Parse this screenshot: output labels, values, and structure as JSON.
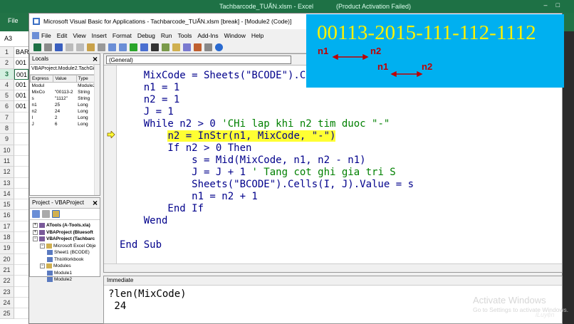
{
  "excel": {
    "title_left": "Tachbarcode_TUẤN.xlsm - Excel",
    "title_right": "(Product Activation Failed)",
    "file_tab": "File",
    "name_box": "A3",
    "rows": [
      {
        "n": "1",
        "c": "BAR"
      },
      {
        "n": "2",
        "c": "001"
      },
      {
        "n": "3",
        "c": "001",
        "sel": true
      },
      {
        "n": "4",
        "c": "001"
      },
      {
        "n": "5",
        "c": "001"
      },
      {
        "n": "6",
        "c": "001"
      },
      {
        "n": "7",
        "c": ""
      },
      {
        "n": "8",
        "c": ""
      },
      {
        "n": "9",
        "c": ""
      },
      {
        "n": "10",
        "c": ""
      },
      {
        "n": "11",
        "c": ""
      },
      {
        "n": "12",
        "c": ""
      },
      {
        "n": "13",
        "c": ""
      },
      {
        "n": "14",
        "c": ""
      },
      {
        "n": "15",
        "c": ""
      },
      {
        "n": "16",
        "c": ""
      },
      {
        "n": "17",
        "c": ""
      },
      {
        "n": "18",
        "c": ""
      },
      {
        "n": "19",
        "c": ""
      },
      {
        "n": "20",
        "c": ""
      },
      {
        "n": "21",
        "c": ""
      },
      {
        "n": "22",
        "c": ""
      },
      {
        "n": "23",
        "c": ""
      },
      {
        "n": "24",
        "c": ""
      },
      {
        "n": "25",
        "c": ""
      }
    ]
  },
  "vba": {
    "title": "Microsoft Visual Basic for Applications - Tachbarcode_TUẤN.xlsm [break] - [Module2 (Code)]",
    "menu": [
      "File",
      "Edit",
      "View",
      "Insert",
      "Format",
      "Debug",
      "Run",
      "Tools",
      "Add-Ins",
      "Window",
      "Help"
    ],
    "locals": {
      "title": "Locals",
      "project_path": "VBAProject.Module2.TachGi",
      "headers": [
        "Express",
        "Value",
        "Type"
      ],
      "rows": [
        {
          "e": "Modul",
          "v": "",
          "t": "Module2/M"
        },
        {
          "e": "MixCo",
          "v": "\"00113-2",
          "t": "String"
        },
        {
          "e": "s",
          "v": "\"1112\"",
          "t": "String"
        },
        {
          "e": "n1",
          "v": "25",
          "t": "Long"
        },
        {
          "e": "n2",
          "v": "24",
          "t": "Long"
        },
        {
          "e": "I",
          "v": "2",
          "t": "Long"
        },
        {
          "e": "J",
          "v": "6",
          "t": "Long"
        }
      ]
    },
    "project": {
      "title": "Project - VBAProject",
      "items": [
        {
          "label": "ATools (A-Tools.xla)",
          "bold": true,
          "indent": 0
        },
        {
          "label": "VBAProject (Bluesoft",
          "bold": true,
          "indent": 0
        },
        {
          "label": "VBAProject (Tachbarc",
          "bold": true,
          "indent": 0
        },
        {
          "label": "Microsoft Excel Obje",
          "bold": false,
          "indent": 1
        },
        {
          "label": "Sheet1 (BCODE)",
          "bold": false,
          "indent": 2
        },
        {
          "label": "ThisWorkbook",
          "bold": false,
          "indent": 2
        },
        {
          "label": "Modules",
          "bold": false,
          "indent": 1
        },
        {
          "label": "Module1",
          "bold": false,
          "indent": 2
        },
        {
          "label": "Module2",
          "bold": false,
          "indent": 2
        }
      ]
    },
    "code": {
      "combo": "(General)",
      "lines": [
        {
          "text": "    MixCode = Sheets(\"BCODE\").C",
          "comment": "",
          "hl": false
        },
        {
          "text": "    n1 = 1",
          "comment": "",
          "hl": false
        },
        {
          "text": "    n2 = 1",
          "comment": "",
          "hl": false
        },
        {
          "text": "    J = 1",
          "comment": "",
          "hl": false
        },
        {
          "text": "    While n2 > 0 ",
          "comment": "'CHi lap khi n2 tim duoc \"-\"",
          "hl": false
        },
        {
          "text": "        ",
          "hltext": "n2 = InStr(n1, MixCode, \"-\")",
          "comment": "",
          "hl": true
        },
        {
          "text": "        If n2 > 0 Then",
          "comment": "",
          "hl": false
        },
        {
          "text": "            s = Mid(MixCode, n1, n2 - n1)",
          "comment": "",
          "hl": false
        },
        {
          "text": "            J = J + 1 ",
          "comment": "' Tang cot ghi gia tri S",
          "hl": false
        },
        {
          "text": "            Sheets(\"BCODE\").Cells(I, J).Value = s",
          "comment": "",
          "hl": false
        },
        {
          "text": "            n1 = n2 + 1",
          "comment": "",
          "hl": false
        },
        {
          "text": "        End If",
          "comment": "",
          "hl": false
        },
        {
          "text": "    Wend",
          "comment": "",
          "hl": false
        },
        {
          "text": "",
          "comment": "",
          "hl": false
        },
        {
          "text": "End Sub",
          "comment": "",
          "hl": false
        }
      ]
    },
    "immediate": {
      "title": "Immediate",
      "lines": [
        "?len(MixCode)",
        " 24"
      ]
    }
  },
  "overlay": {
    "code": "00113-2015-111-112-1112",
    "labels": [
      {
        "text": "n1",
        "pos": "a1"
      },
      {
        "text": "n2",
        "pos": "a2"
      },
      {
        "text": "n1",
        "pos": "b1"
      },
      {
        "text": "n2",
        "pos": "b2"
      }
    ]
  },
  "watermark": {
    "line1": "Activate Windows",
    "line2": "Go to Settings to activate Windows.",
    "logo": "iLuyện"
  },
  "colors": {
    "excel_green": "#217346",
    "overlay_bg": "#00b0f0",
    "overlay_text": "#fff200",
    "highlight": "#ffff33",
    "code_blue": "#00008b",
    "comment_green": "#008000"
  }
}
